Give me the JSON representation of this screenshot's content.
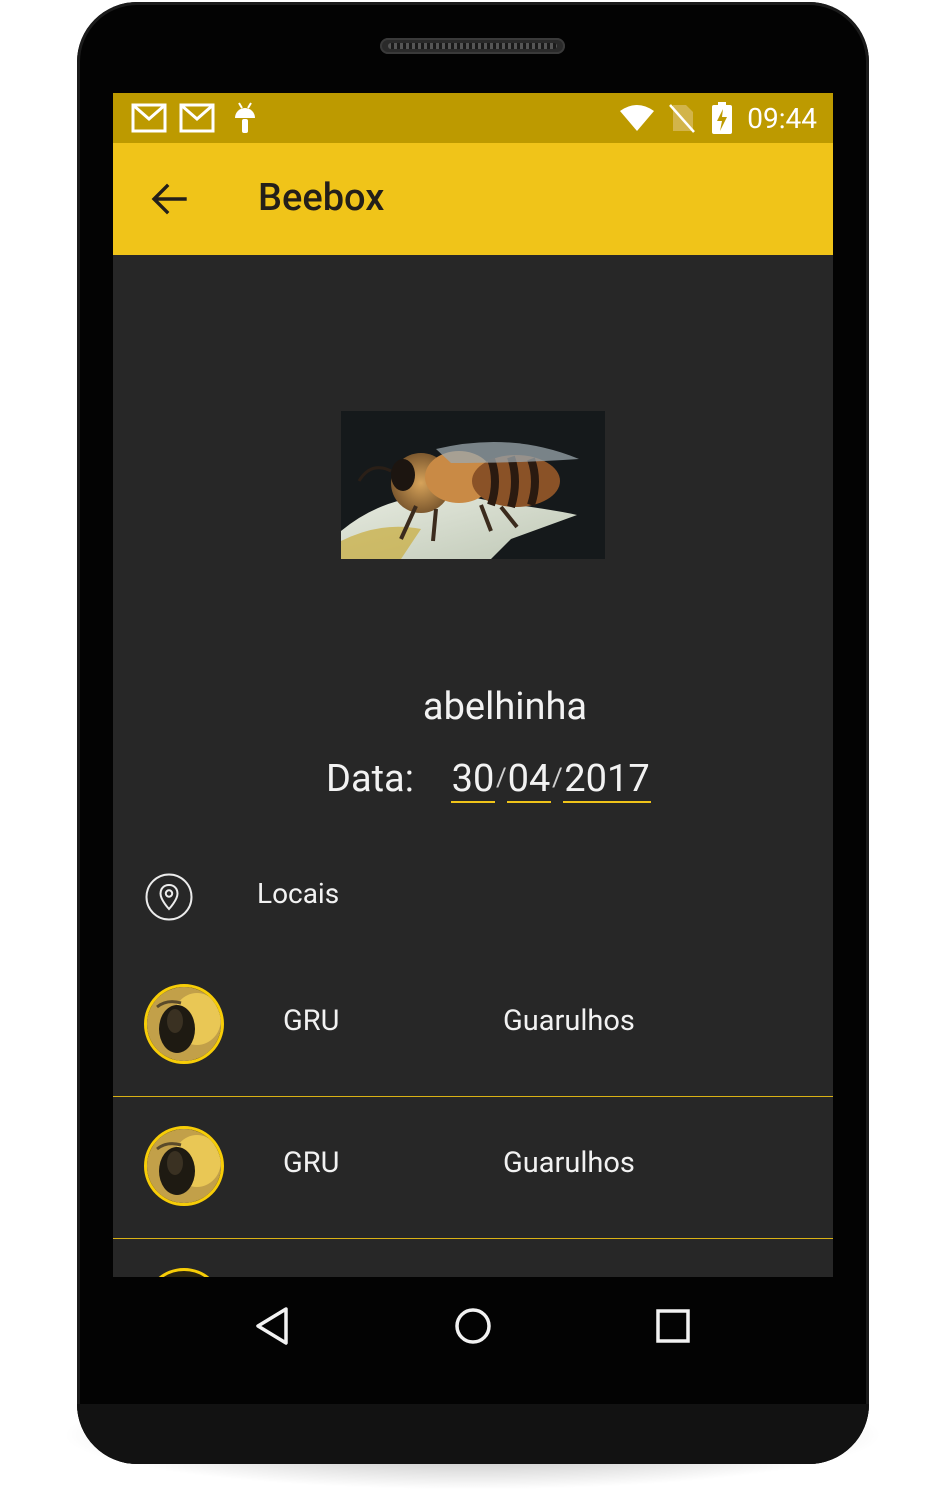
{
  "status_bar": {
    "time": "09:44",
    "icons": [
      "gmail-icon",
      "gmail-icon",
      "android-icon",
      "wifi-icon",
      "no-sim-icon",
      "battery-charging-icon"
    ]
  },
  "app_bar": {
    "title": "Beebox",
    "back_icon": "arrow-left-icon"
  },
  "detail": {
    "name": "abelhinha",
    "date_label": "Data:",
    "date": {
      "day": "30",
      "month": "04",
      "year": "2017",
      "separator": "/"
    }
  },
  "locais": {
    "label": "Locais",
    "icon": "map-pin-icon"
  },
  "locations": [
    {
      "code": "GRU",
      "city": "Guarulhos"
    },
    {
      "code": "GRU",
      "city": "Guarulhos"
    }
  ],
  "nav_bar": {
    "buttons": [
      "back-triangle-icon",
      "home-circle-icon",
      "recents-square-icon"
    ]
  },
  "colors": {
    "status_bar": "#bd9a00",
    "app_bar": "#f0c419",
    "background": "#272727",
    "accent": "#f0c419"
  }
}
